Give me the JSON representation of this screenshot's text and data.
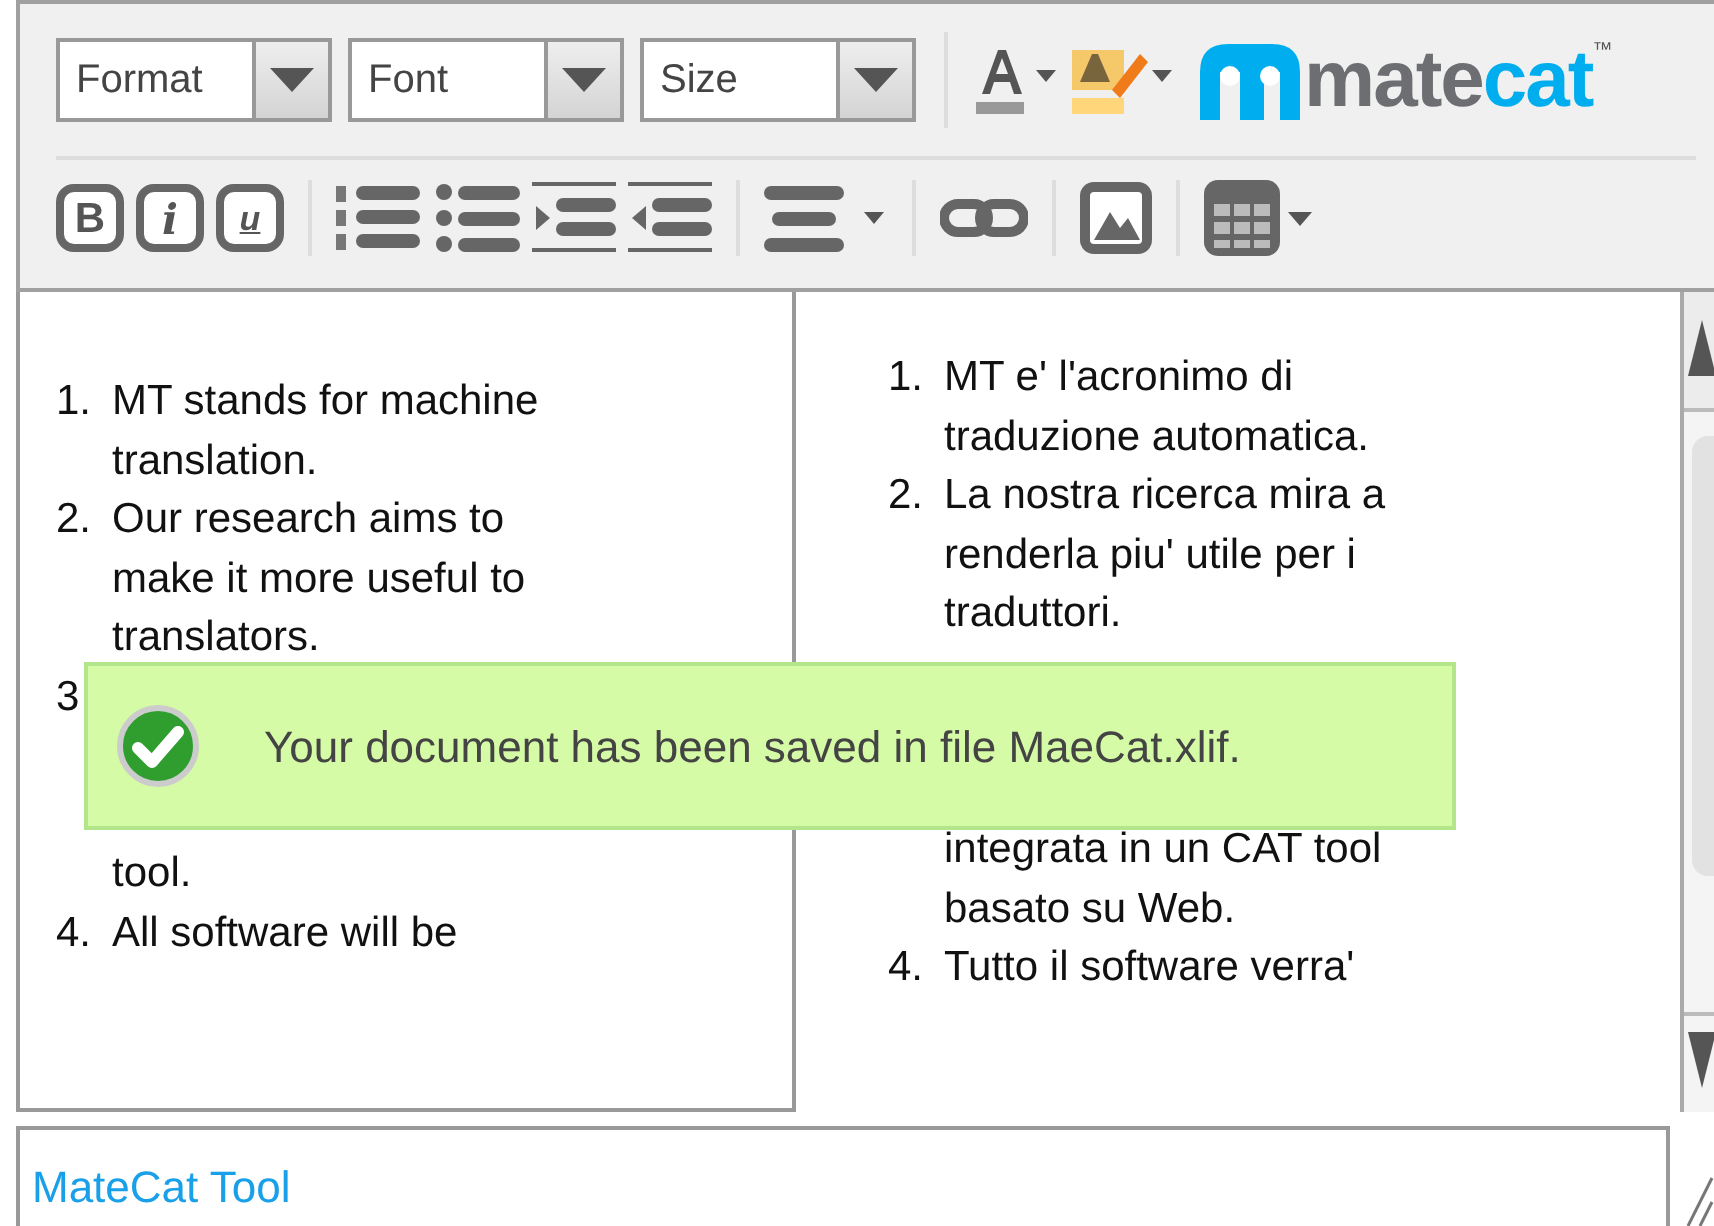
{
  "toolbar": {
    "dropdowns": [
      {
        "placeholder": "Format"
      },
      {
        "placeholder": "Font"
      },
      {
        "placeholder": "Size"
      }
    ],
    "format_buttons": [
      {
        "label": "B",
        "kind": "bold"
      },
      {
        "label": "i",
        "kind": "italic"
      },
      {
        "label": "u",
        "kind": "underline"
      }
    ],
    "logo": {
      "text_dark": "mate",
      "text_light": "cat",
      "mark": "™"
    }
  },
  "source": {
    "items": [
      {
        "number": "1.",
        "lines": [
          "MT stands for machine",
          "translation."
        ]
      },
      {
        "number": "2.",
        "lines": [
          "Our research aims to",
          "make it more useful to",
          "translators."
        ]
      },
      {
        "number": "3",
        "covered": true,
        "lines": [
          "tool."
        ]
      },
      {
        "number": "4.",
        "lines": [
          "All software will be"
        ]
      }
    ]
  },
  "target": {
    "items": [
      {
        "number": "1.",
        "lines": [
          "MT e' l'acronimo di",
          "traduzione automatica."
        ]
      },
      {
        "number": "2.",
        "lines": [
          "La nostra ricerca mira a",
          "renderla piu' utile per i",
          "traduttori."
        ]
      },
      {
        "covered": true,
        "lines": [
          "integrata in un CAT tool",
          "basato su Web."
        ]
      },
      {
        "number": "4.",
        "lines": [
          "Tutto il software verra'"
        ]
      }
    ]
  },
  "notification": {
    "kind": "success",
    "message": "Your document has been saved in file MaeCat.xlif."
  },
  "footer_field": {
    "value": "MateCat Tool"
  }
}
